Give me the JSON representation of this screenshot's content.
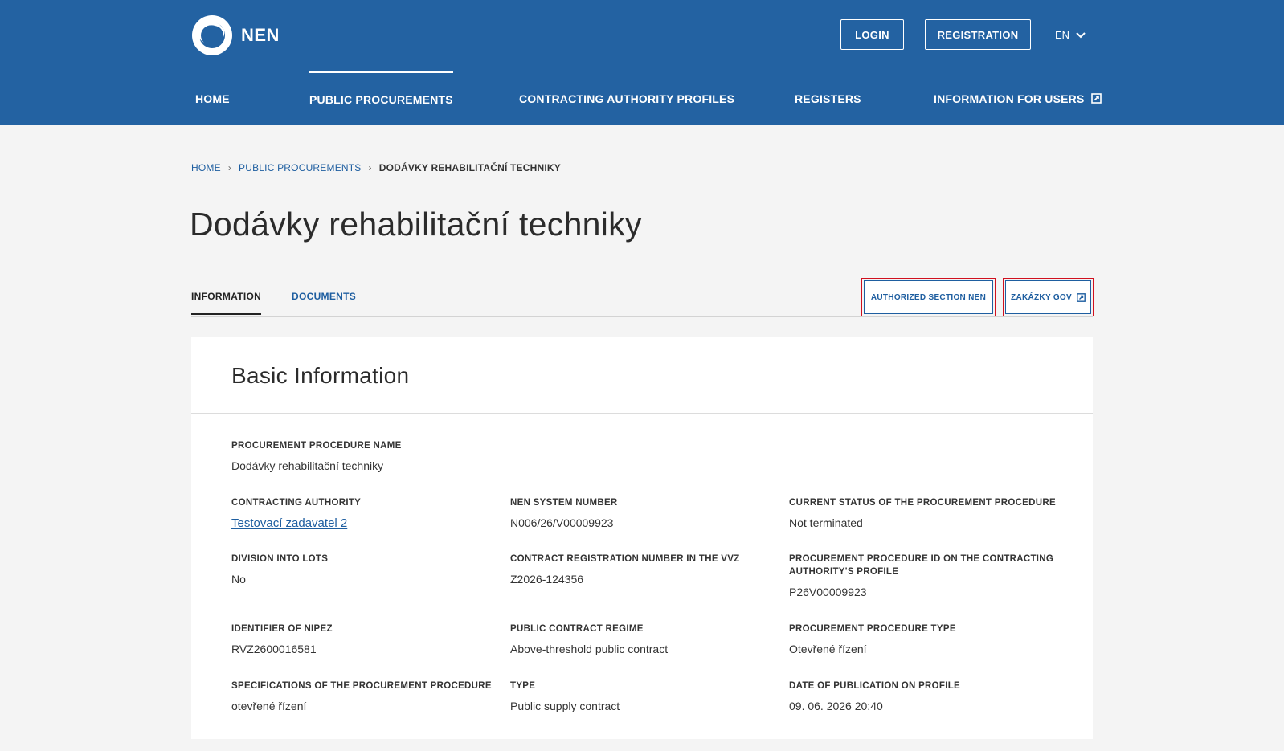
{
  "header": {
    "logo_text": "NEN",
    "login_label": "LOGIN",
    "registration_label": "REGISTRATION",
    "language": "EN"
  },
  "nav": {
    "items": [
      {
        "label": "HOME"
      },
      {
        "label": "PUBLIC PROCUREMENTS"
      },
      {
        "label": "CONTRACTING AUTHORITY PROFILES"
      },
      {
        "label": "REGISTERS"
      },
      {
        "label": "INFORMATION FOR USERS"
      }
    ],
    "active": "PUBLIC PROCUREMENTS"
  },
  "breadcrumb": {
    "home": "HOME",
    "procurements": "PUBLIC PROCUREMENTS",
    "current": "DODÁVKY REHABILITAČNÍ TECHNIKY"
  },
  "page": {
    "title": "Dodávky rehabilitační techniky"
  },
  "tabs": {
    "information": "INFORMATION",
    "documents": "DOCUMENTS",
    "active": "INFORMATION"
  },
  "actions": {
    "authorized_section": "AUTHORIZED SECTION NEN",
    "zakazky_gov": "ZAKÁZKY GOV"
  },
  "basic_info": {
    "title": "Basic Information",
    "procedure_name": {
      "label": "PROCUREMENT PROCEDURE NAME",
      "value": "Dodávky rehabilitační techniky"
    },
    "contracting_authority": {
      "label": "CONTRACTING AUTHORITY",
      "value": "Testovací zadavatel 2"
    },
    "nen_system_number": {
      "label": "NEN SYSTEM NUMBER",
      "value": "N006/26/V00009923"
    },
    "current_status": {
      "label": "CURRENT STATUS OF THE PROCUREMENT PROCEDURE",
      "value": "Not terminated"
    },
    "division_into_lots": {
      "label": "DIVISION INTO LOTS",
      "value": "No"
    },
    "contract_registration": {
      "label": "CONTRACT REGISTRATION NUMBER IN THE VVZ",
      "value": "Z2026-124356"
    },
    "procedure_id_profile": {
      "label": "PROCUREMENT PROCEDURE ID ON THE CONTRACTING AUTHORITY'S PROFILE",
      "value": "P26V00009923"
    },
    "identifier_nipez": {
      "label": "IDENTIFIER OF NIPEZ",
      "value": "RVZ2600016581"
    },
    "contract_regime": {
      "label": "PUBLIC CONTRACT REGIME",
      "value": "Above-threshold public contract"
    },
    "procedure_type": {
      "label": "PROCUREMENT PROCEDURE TYPE",
      "value": "Otevřené řízení"
    },
    "specifications": {
      "label": "SPECIFICATIONS OF THE PROCUREMENT PROCEDURE",
      "value": "otevřené řízení"
    },
    "type": {
      "label": "TYPE",
      "value": "Public supply contract"
    },
    "publication_date": {
      "label": "DATE OF PUBLICATION ON PROFILE",
      "value": "09. 06. 2026 20:40"
    }
  },
  "colors": {
    "header_bg": "#2362a2",
    "link": "#1e5ea0",
    "highlight_outline": "#d0101f",
    "page_bg": "#f4f4f4"
  }
}
